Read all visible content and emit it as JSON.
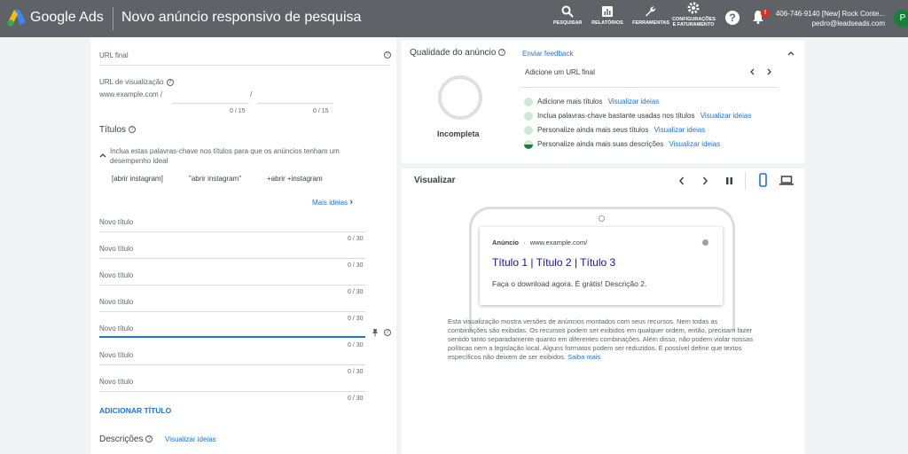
{
  "header": {
    "brand": "Google Ads",
    "page_title": "Novo anúncio responsivo de pesquisa",
    "tools": [
      {
        "label": "PESQUISAR",
        "icon": "search-icon"
      },
      {
        "label": "RELATÓRIOS",
        "icon": "reports-icon"
      },
      {
        "label": "FERRAMENTAS",
        "icon": "wrench-icon"
      },
      {
        "label": "CONFIGURAÇÕES E FATURAMENTO",
        "icon": "gear-icon"
      }
    ],
    "notification_badge": "!",
    "account_line1": "406-746-9140 [New] Rock Conte...",
    "account_line2": "pedro@leadseads.com",
    "avatar_letter": "P"
  },
  "form": {
    "final_url_label": "URL final",
    "display_url_label": "URL de visualização",
    "display_url_prefix": "www.example.com /",
    "display_url_sep": "/",
    "path_counter_1": "0 / 15",
    "path_counter_2": "0 / 15",
    "headlines_title": "Títulos",
    "keyword_hint": "Inclua estas palavras-chave nos títulos para que os anúncios tenham um desempenho ideal",
    "keywords": [
      "[abrir instagram]",
      "\"abrir instagram\"",
      "+abrir +instagram"
    ],
    "more_ideas": "Mais ideias",
    "headline_placeholder": "Novo título",
    "headline_counter": "0 / 30",
    "add_headline": "ADICIONAR TÍTULO",
    "descriptions_title": "Descrições",
    "view_ideas": "Visualizar ideias"
  },
  "quality": {
    "title": "Qualidade do anúncio",
    "feedback": "Enviar feedback",
    "status": "Incompleta",
    "top_suggestion": "Adicione um URL final",
    "suggestions": [
      {
        "text": "Adicione mais títulos",
        "link": "Visualizar ideias"
      },
      {
        "text": "Inclua palavras-chave bastante usadas nos títulos",
        "link": "Visualizar ideias"
      },
      {
        "text": "Personalize ainda mais seus títulos",
        "link": "Visualizar ideias"
      },
      {
        "text": "Personalize ainda mais suas descrições",
        "link": "Visualizar ideias"
      }
    ]
  },
  "preview": {
    "title": "Visualizar",
    "ad_label": "Anúncio",
    "ad_url": "www.example.com/",
    "ad_headline": "Título 1 | Título 2 | Título 3",
    "ad_description": "Faça o download agora. É grátis! Descrição 2.",
    "disclaimer": "Esta visualização mostra versões de anúncios montados com seus recursos. Nem todas as combinações são exibidas. Os recursos podem ser exibidos em qualquer ordem, então, precisam fazer sentido tanto separadamente quanto em diferentes combinações. Além disso, não podem violar nossas políticas nem a legislação local. Alguns formatos podem ser reduzidos. É possível definir que textos específicos não deixem de ser exibidos.",
    "learn_more": "Saiba mais"
  }
}
